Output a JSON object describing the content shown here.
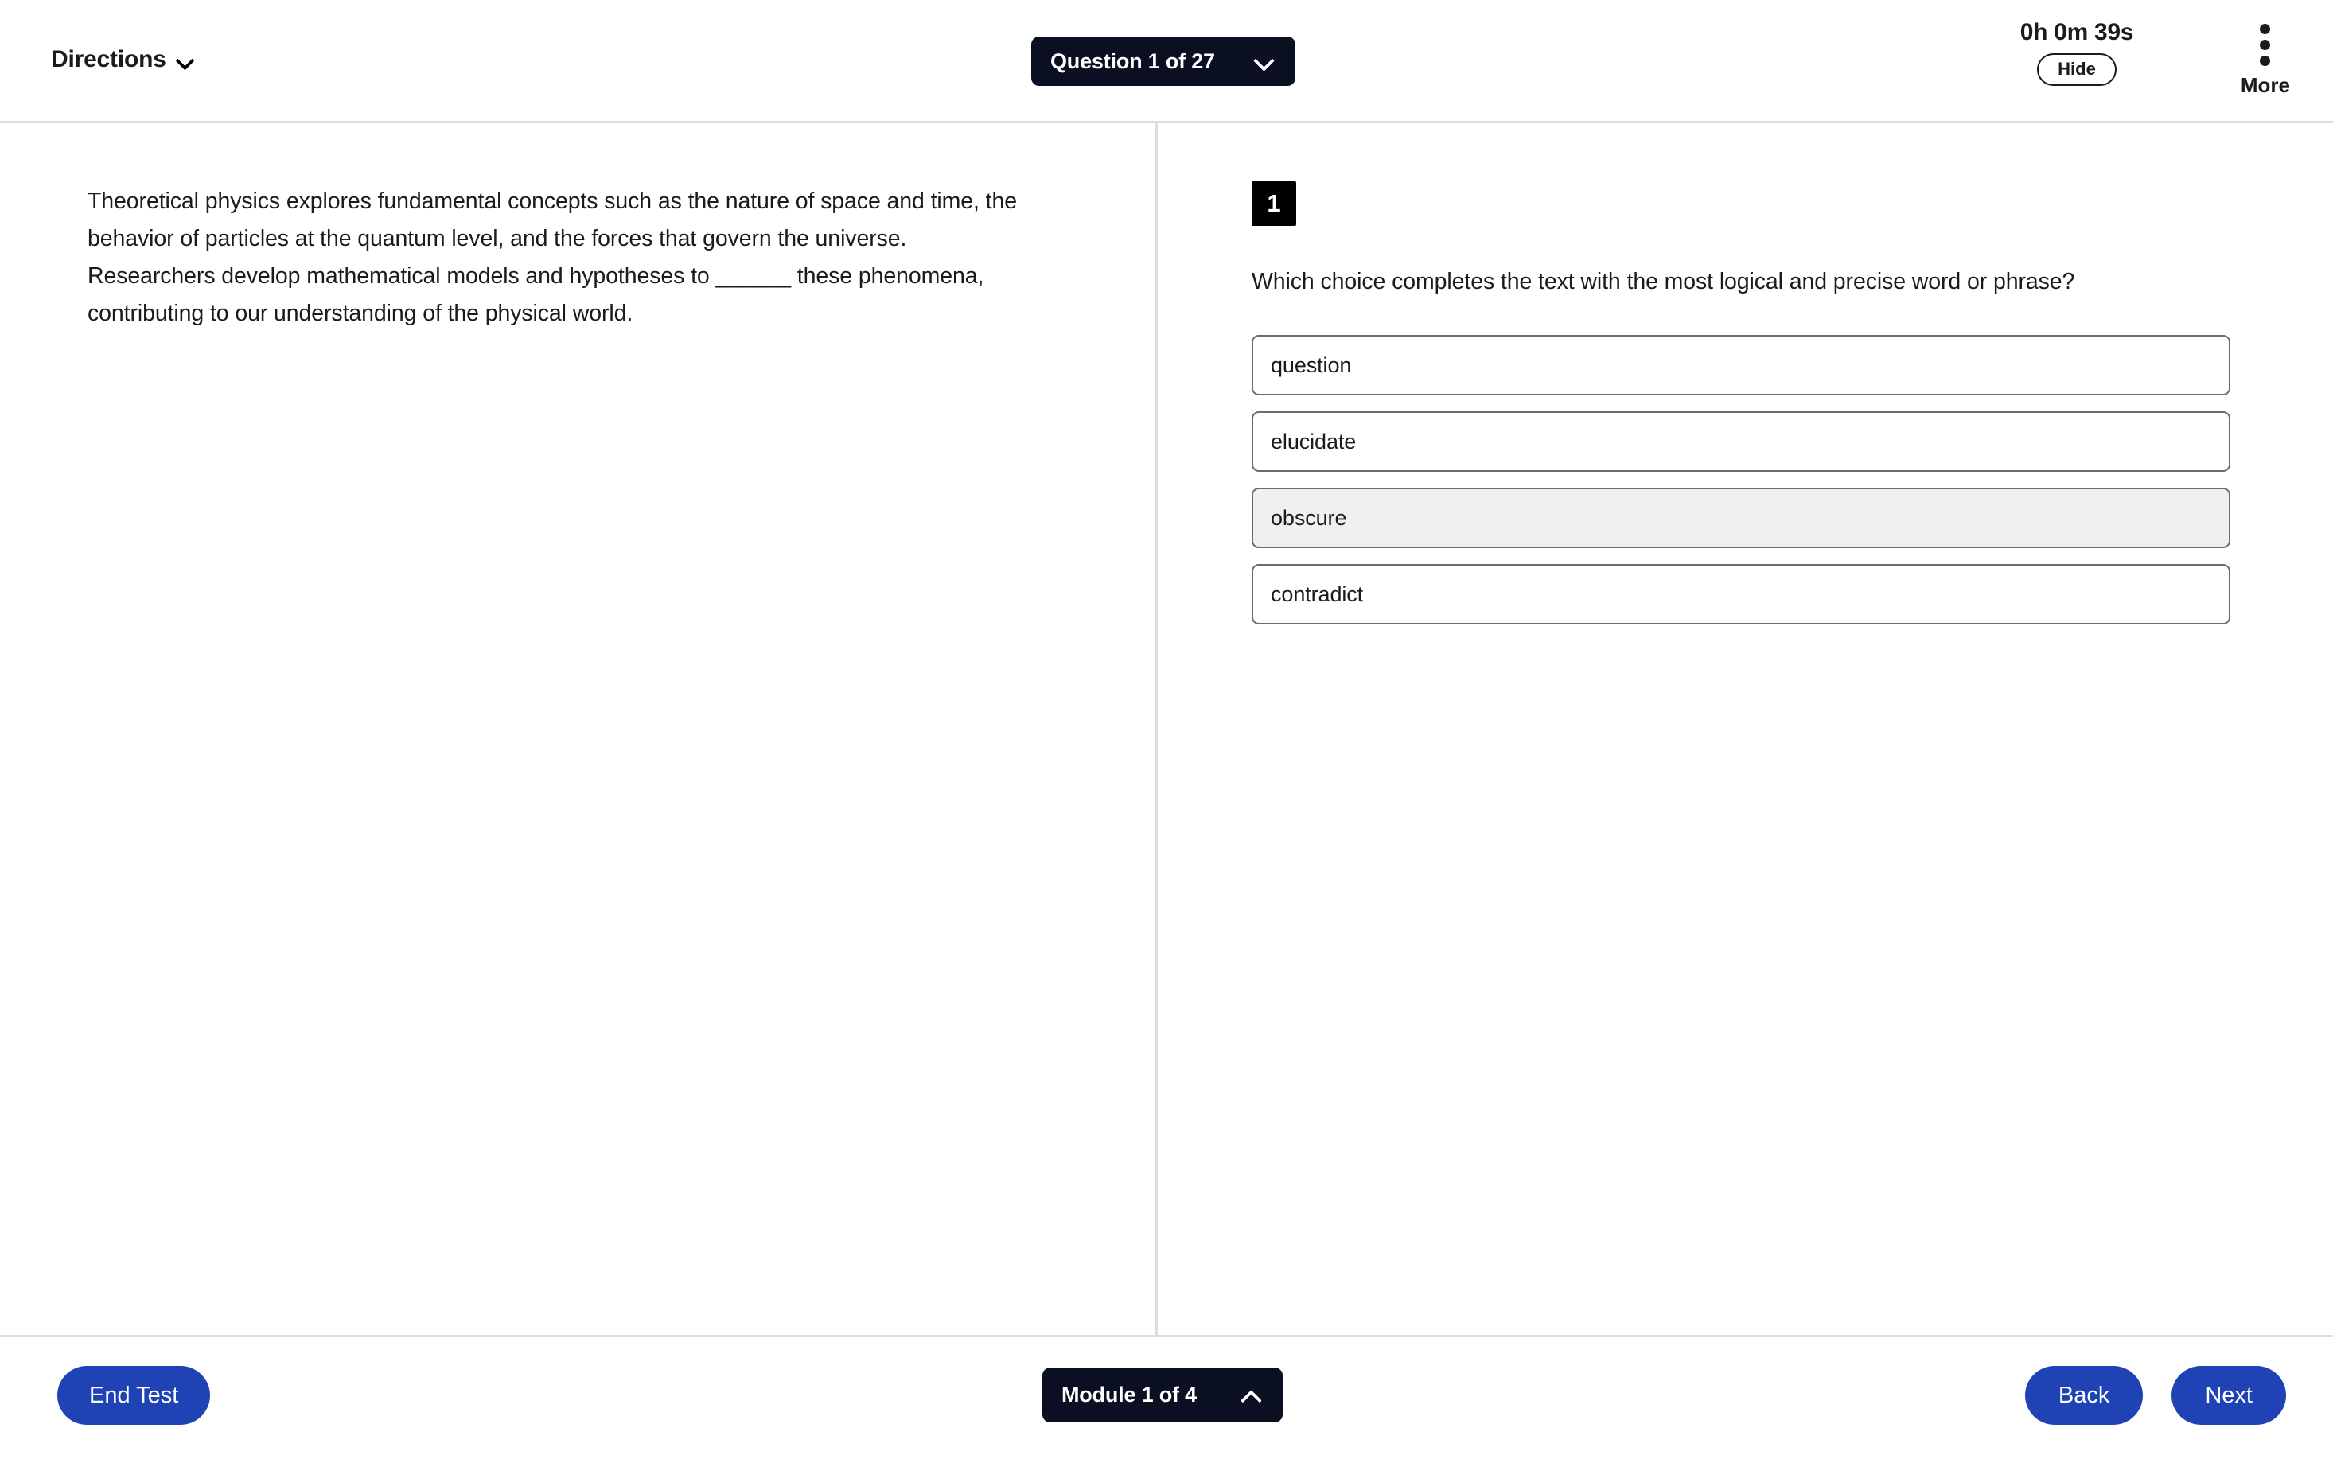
{
  "header": {
    "directions_label": "Directions",
    "directions_icon": "chevron-down-icon",
    "question_pill": {
      "label": "Question 1 of 27",
      "icon": "chevron-down-icon",
      "background": "#0a1021"
    },
    "timer": {
      "value": "0h 0m 39s",
      "hide_label": "Hide"
    },
    "more": {
      "label": "More",
      "icon": "kebab-menu-icon"
    }
  },
  "main": {
    "passage": "Theoretical physics explores fundamental concepts such as the nature of space and time, the behavior of particles at the quantum level, and the forces that govern the universe. Researchers develop mathematical models and hypotheses to ______ these phenomena, contributing to our understanding of the physical world.",
    "question_number": "1",
    "question_prompt": "Which choice completes the text with the most logical and precise word or phrase?",
    "choices": [
      {
        "text": "question",
        "selected": false
      },
      {
        "text": "elucidate",
        "selected": false
      },
      {
        "text": "obscure",
        "selected": true
      },
      {
        "text": "contradict",
        "selected": false
      }
    ],
    "selected_choice_background": "#f0f0f0"
  },
  "footer": {
    "end_test_label": "End Test",
    "module_pill": {
      "label": "Module 1 of 4",
      "icon": "chevron-up-icon",
      "background": "#0a1021"
    },
    "back_label": "Back",
    "next_label": "Next",
    "button_color": "#1f43b5"
  }
}
